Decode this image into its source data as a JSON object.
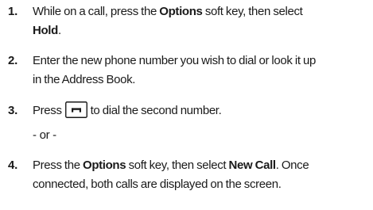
{
  "steps": [
    {
      "number": "1.",
      "t1": "While on a call, press the ",
      "b1": "Options",
      "t2": " soft key, then select",
      "b2": "Hold",
      "t3": "."
    },
    {
      "number": "2.",
      "line1": "Enter the new phone number you wish to dial or look it up",
      "line2": "in the Address Book."
    },
    {
      "number": "3.",
      "t1": "Press",
      "icon": "end-call-key-icon",
      "t2": "to dial the second number."
    },
    {
      "separator": "- or -"
    },
    {
      "number": "4.",
      "t1": "Press the ",
      "b1": "Options",
      "t2": " soft key, then select ",
      "b2": "New Call",
      "t3": ". Once",
      "line2": "connected, both calls are displayed on the screen."
    }
  ]
}
